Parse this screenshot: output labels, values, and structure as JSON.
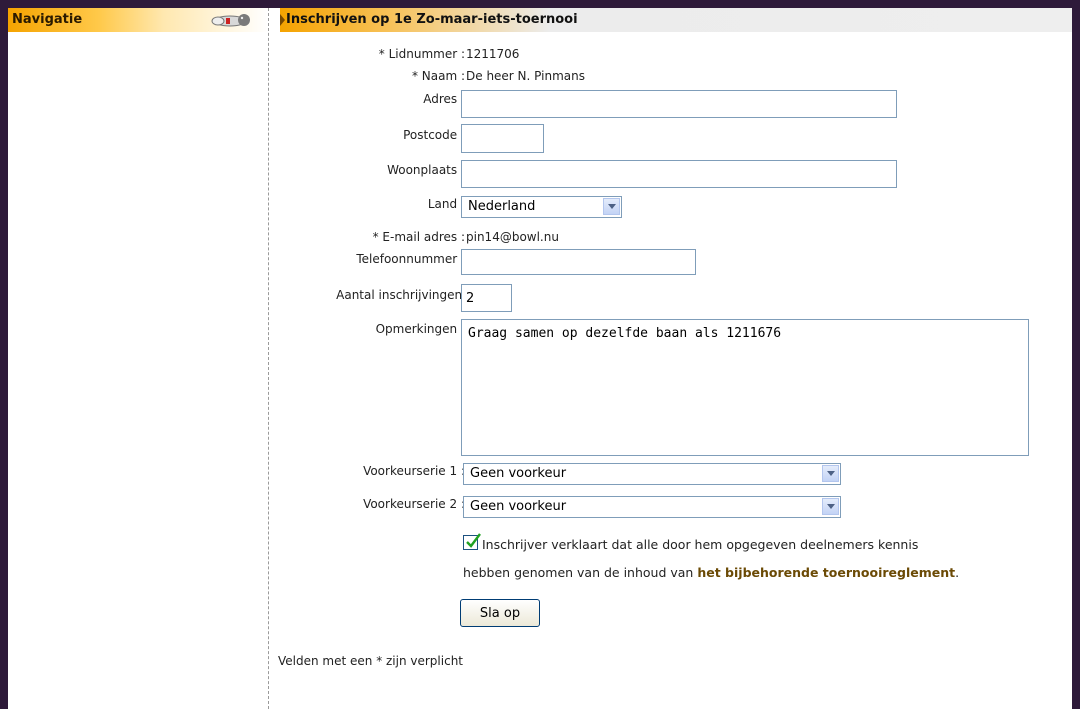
{
  "sidebar": {
    "title": "Navigatie",
    "icon": "bowling-pin-icon"
  },
  "main": {
    "title": "Inschrijven op 1e Zo-maar-iets-toernooi"
  },
  "form": {
    "lidnummer_label": "* Lidnummer :",
    "lidnummer_value": "1211706",
    "naam_label": "* Naam :",
    "naam_value": "De heer N. Pinmans",
    "adres_label": "Adres :",
    "adres_value": "",
    "postcode_label": "Postcode :",
    "postcode_value": "",
    "woonplaats_label": "Woonplaats :",
    "woonplaats_value": "",
    "land_label": "Land :",
    "land_value": "Nederland",
    "email_label": "* E-mail adres :",
    "email_value": "pin14@bowl.nu",
    "telefoon_label": "Telefoonnummer :",
    "telefoon_value": "",
    "aantal_label": "Aantal inschrijvingen :",
    "aantal_value": "2",
    "opmerkingen_label": "Opmerkingen :",
    "opmerkingen_value": "Graag samen op dezelfde baan als 1211676",
    "voorkeur1_label": "Voorkeurserie 1 :",
    "voorkeur1_value": "Geen voorkeur",
    "voorkeur2_label": "Voorkeurserie 2 :",
    "voorkeur2_value": "Geen voorkeur",
    "declaration_line1": "Inschrijver verklaart dat alle door hem opgegeven deelnemers kennis",
    "declaration_line2": "hebben genomen van de inhoud van",
    "declaration_link": "het bijbehorende toernooireglement",
    "declaration_end": ".",
    "declaration_checked": true,
    "save_label": "Sla op",
    "required_note": "Velden met een * zijn verplicht"
  }
}
